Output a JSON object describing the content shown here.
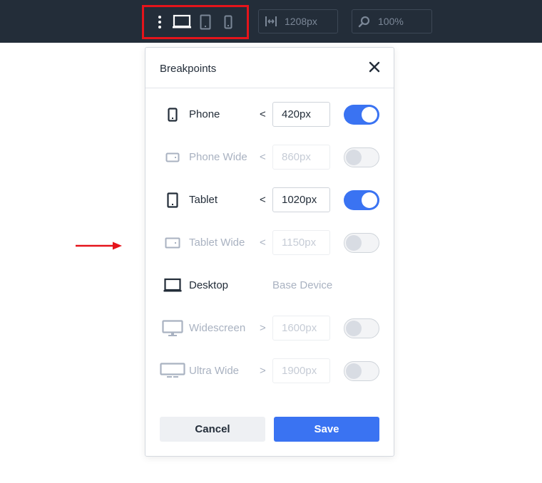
{
  "toolbar": {
    "width_value": "1208px",
    "zoom_value": "100%",
    "device_icons": [
      "more-vertical-icon",
      "desktop-icon",
      "tablet-icon",
      "phone-icon"
    ]
  },
  "modal": {
    "title": "Breakpoints",
    "rows": [
      {
        "label": "Phone",
        "operator": "<",
        "value": "420px",
        "enabled": true,
        "icon": "phone-icon"
      },
      {
        "label": "Phone Wide",
        "operator": "<",
        "value": "860px",
        "enabled": false,
        "icon": "phone-landscape-icon"
      },
      {
        "label": "Tablet",
        "operator": "<",
        "value": "1020px",
        "enabled": true,
        "icon": "tablet-icon"
      },
      {
        "label": "Tablet Wide",
        "operator": "<",
        "value": "1150px",
        "enabled": false,
        "icon": "tablet-landscape-icon"
      },
      {
        "label": "Desktop",
        "base_text": "Base Device",
        "icon": "desktop-icon"
      },
      {
        "label": "Widescreen",
        "operator": ">",
        "value": "1600px",
        "enabled": false,
        "icon": "monitor-icon"
      },
      {
        "label": "Ultra Wide",
        "operator": ">",
        "value": "1900px",
        "enabled": false,
        "icon": "wide-monitor-icon"
      }
    ],
    "cancel_label": "Cancel",
    "save_label": "Save"
  },
  "colors": {
    "topbar": "#232d39",
    "accent": "#3a73f2",
    "highlight": "#e5141b"
  }
}
